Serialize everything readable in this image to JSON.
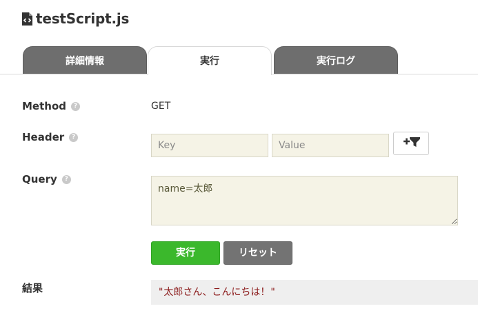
{
  "file": {
    "title": "testScript.js",
    "icon": "js-file-icon"
  },
  "tabs": [
    {
      "label": "詳細情報",
      "active": false
    },
    {
      "label": "実行",
      "active": true
    },
    {
      "label": "実行ログ",
      "active": false
    }
  ],
  "form": {
    "method": {
      "label": "Method",
      "help": "?",
      "value": "GET"
    },
    "header": {
      "label": "Header",
      "help": "?",
      "key_placeholder": "Key",
      "value_placeholder": "Value",
      "add_icon": "plus-filter-icon"
    },
    "query": {
      "label": "Query",
      "help": "?",
      "value": "name=太郎"
    },
    "buttons": {
      "run": "実行",
      "reset": "リセット"
    },
    "result": {
      "label": "結果",
      "value": "\"太郎さん、こんにちは！\""
    }
  },
  "colors": {
    "tab_inactive": "#6e6e6e",
    "run_button": "#3bb82c",
    "reset_button": "#737373",
    "input_bg": "#f5f3e6",
    "result_text": "#8b1a1a"
  }
}
